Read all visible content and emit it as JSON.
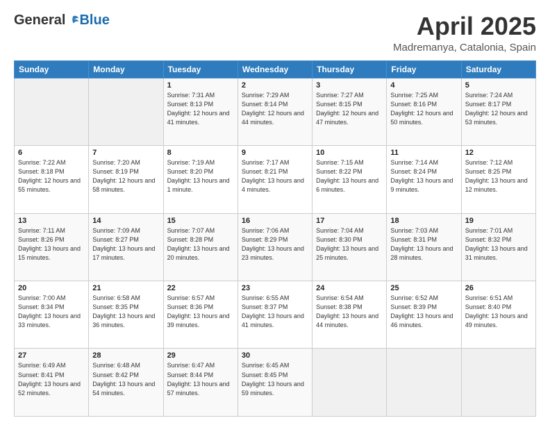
{
  "header": {
    "logo_general": "General",
    "logo_blue": "Blue",
    "month": "April 2025",
    "location": "Madremanya, Catalonia, Spain"
  },
  "days_of_week": [
    "Sunday",
    "Monday",
    "Tuesday",
    "Wednesday",
    "Thursday",
    "Friday",
    "Saturday"
  ],
  "weeks": [
    [
      {
        "day": "",
        "empty": true
      },
      {
        "day": "",
        "empty": true
      },
      {
        "day": "1",
        "sunrise": "7:31 AM",
        "sunset": "8:13 PM",
        "daylight": "12 hours and 41 minutes."
      },
      {
        "day": "2",
        "sunrise": "7:29 AM",
        "sunset": "8:14 PM",
        "daylight": "12 hours and 44 minutes."
      },
      {
        "day": "3",
        "sunrise": "7:27 AM",
        "sunset": "8:15 PM",
        "daylight": "12 hours and 47 minutes."
      },
      {
        "day": "4",
        "sunrise": "7:25 AM",
        "sunset": "8:16 PM",
        "daylight": "12 hours and 50 minutes."
      },
      {
        "day": "5",
        "sunrise": "7:24 AM",
        "sunset": "8:17 PM",
        "daylight": "12 hours and 53 minutes."
      }
    ],
    [
      {
        "day": "6",
        "sunrise": "7:22 AM",
        "sunset": "8:18 PM",
        "daylight": "12 hours and 55 minutes."
      },
      {
        "day": "7",
        "sunrise": "7:20 AM",
        "sunset": "8:19 PM",
        "daylight": "12 hours and 58 minutes."
      },
      {
        "day": "8",
        "sunrise": "7:19 AM",
        "sunset": "8:20 PM",
        "daylight": "13 hours and 1 minute."
      },
      {
        "day": "9",
        "sunrise": "7:17 AM",
        "sunset": "8:21 PM",
        "daylight": "13 hours and 4 minutes."
      },
      {
        "day": "10",
        "sunrise": "7:15 AM",
        "sunset": "8:22 PM",
        "daylight": "13 hours and 6 minutes."
      },
      {
        "day": "11",
        "sunrise": "7:14 AM",
        "sunset": "8:24 PM",
        "daylight": "13 hours and 9 minutes."
      },
      {
        "day": "12",
        "sunrise": "7:12 AM",
        "sunset": "8:25 PM",
        "daylight": "13 hours and 12 minutes."
      }
    ],
    [
      {
        "day": "13",
        "sunrise": "7:11 AM",
        "sunset": "8:26 PM",
        "daylight": "13 hours and 15 minutes."
      },
      {
        "day": "14",
        "sunrise": "7:09 AM",
        "sunset": "8:27 PM",
        "daylight": "13 hours and 17 minutes."
      },
      {
        "day": "15",
        "sunrise": "7:07 AM",
        "sunset": "8:28 PM",
        "daylight": "13 hours and 20 minutes."
      },
      {
        "day": "16",
        "sunrise": "7:06 AM",
        "sunset": "8:29 PM",
        "daylight": "13 hours and 23 minutes."
      },
      {
        "day": "17",
        "sunrise": "7:04 AM",
        "sunset": "8:30 PM",
        "daylight": "13 hours and 25 minutes."
      },
      {
        "day": "18",
        "sunrise": "7:03 AM",
        "sunset": "8:31 PM",
        "daylight": "13 hours and 28 minutes."
      },
      {
        "day": "19",
        "sunrise": "7:01 AM",
        "sunset": "8:32 PM",
        "daylight": "13 hours and 31 minutes."
      }
    ],
    [
      {
        "day": "20",
        "sunrise": "7:00 AM",
        "sunset": "8:34 PM",
        "daylight": "13 hours and 33 minutes."
      },
      {
        "day": "21",
        "sunrise": "6:58 AM",
        "sunset": "8:35 PM",
        "daylight": "13 hours and 36 minutes."
      },
      {
        "day": "22",
        "sunrise": "6:57 AM",
        "sunset": "8:36 PM",
        "daylight": "13 hours and 39 minutes."
      },
      {
        "day": "23",
        "sunrise": "6:55 AM",
        "sunset": "8:37 PM",
        "daylight": "13 hours and 41 minutes."
      },
      {
        "day": "24",
        "sunrise": "6:54 AM",
        "sunset": "8:38 PM",
        "daylight": "13 hours and 44 minutes."
      },
      {
        "day": "25",
        "sunrise": "6:52 AM",
        "sunset": "8:39 PM",
        "daylight": "13 hours and 46 minutes."
      },
      {
        "day": "26",
        "sunrise": "6:51 AM",
        "sunset": "8:40 PM",
        "daylight": "13 hours and 49 minutes."
      }
    ],
    [
      {
        "day": "27",
        "sunrise": "6:49 AM",
        "sunset": "8:41 PM",
        "daylight": "13 hours and 52 minutes."
      },
      {
        "day": "28",
        "sunrise": "6:48 AM",
        "sunset": "8:42 PM",
        "daylight": "13 hours and 54 minutes."
      },
      {
        "day": "29",
        "sunrise": "6:47 AM",
        "sunset": "8:44 PM",
        "daylight": "13 hours and 57 minutes."
      },
      {
        "day": "30",
        "sunrise": "6:45 AM",
        "sunset": "8:45 PM",
        "daylight": "13 hours and 59 minutes."
      },
      {
        "day": "",
        "empty": true
      },
      {
        "day": "",
        "empty": true
      },
      {
        "day": "",
        "empty": true
      }
    ]
  ]
}
